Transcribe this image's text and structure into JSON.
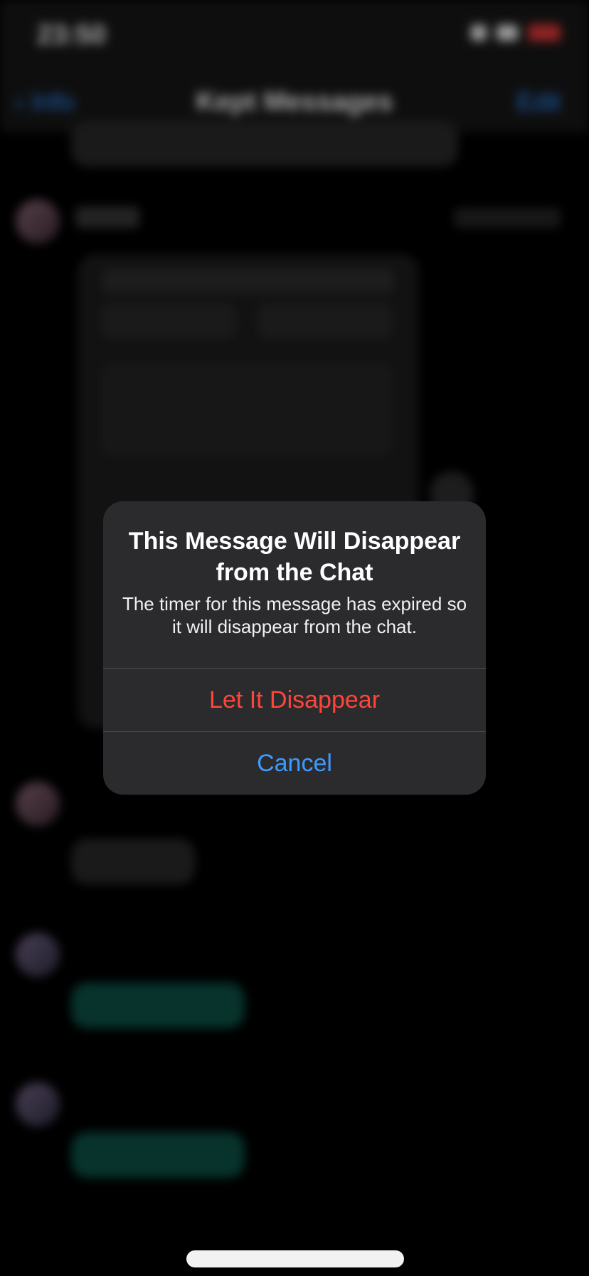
{
  "status_bar": {
    "time": "23:50"
  },
  "nav": {
    "back_label": "Info",
    "title": "Kept Messages",
    "edit_label": "Edit"
  },
  "alert": {
    "title": "This Message Will Disappear from the Chat",
    "message": "The timer for this message has expired so it will disappear from the chat.",
    "destructive_label": "Let It Disappear",
    "cancel_label": "Cancel"
  },
  "colors": {
    "destructive": "#ff453a",
    "action": "#3c9bff",
    "dialog_bg": "#2b2b2d"
  }
}
